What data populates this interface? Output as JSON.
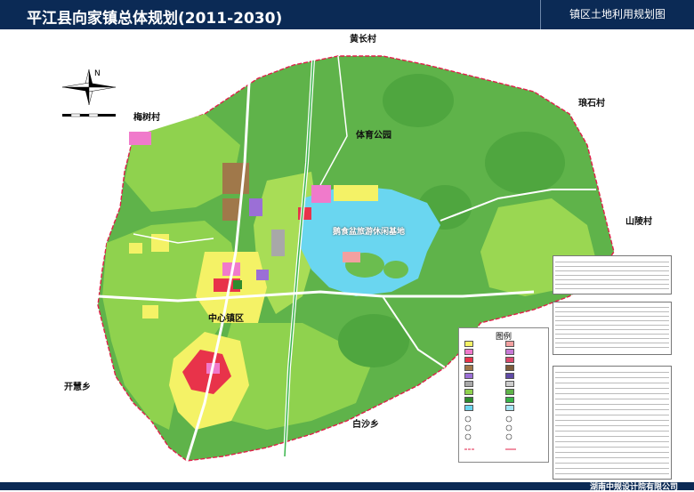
{
  "header": {
    "title": "平江县向家镇总体规划(2011-2030)",
    "subtitle": "镇区土地利用规划图"
  },
  "footer": {
    "org": "湖南中规设计院有限公司"
  },
  "compass": {
    "north_label": "N"
  },
  "village_labels": {
    "huangchang": "黄长村",
    "meishu": "梅树村",
    "langshi": "琅石村",
    "shanling": "山陵村",
    "kaihui": "开慧乡",
    "baisha": "白沙乡"
  },
  "place_labels": {
    "tiyu_park": "体育公园",
    "center_town": "中心镇区",
    "resort": "鹅食盆旅游休闲基地"
  },
  "legend": {
    "title": "图例"
  },
  "colors": {
    "header_bg": "#0b2a55",
    "forest": "#5fb34a",
    "green_land": "#8fd24e",
    "residential": "#f4f266",
    "water": "#6ad6f0",
    "commercial": "#e8334a",
    "admin": "#f07acb",
    "brown": "#a0784a",
    "purple": "#9b6fd6",
    "road": "#ffffff",
    "boundary": "#e0204a"
  }
}
